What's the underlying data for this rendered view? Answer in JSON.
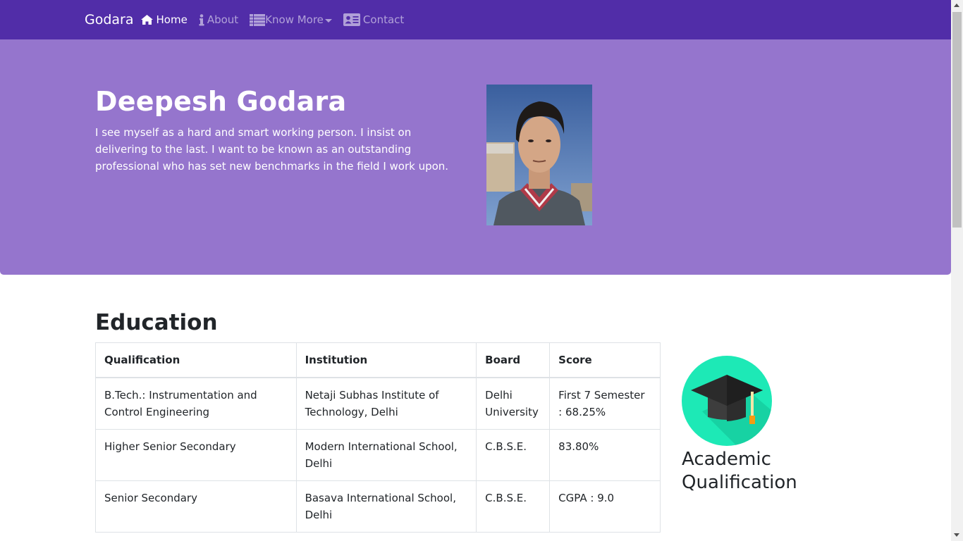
{
  "navbar": {
    "brand": "Godara",
    "items": [
      {
        "label": "Home",
        "icon": "home-icon"
      },
      {
        "label": "About",
        "icon": "info-icon"
      },
      {
        "label": "Know More",
        "icon": "list-icon"
      },
      {
        "label": "Contact",
        "icon": "address-card-icon"
      }
    ]
  },
  "hero": {
    "name": "Deepesh Godara",
    "description": "I see myself as a hard and smart working person. I insist on delivering to the last. I want to be known as an outstanding professional who has set new benchmarks in the field I work upon."
  },
  "education": {
    "title": "Education",
    "headers": [
      "Qualification",
      "Institution",
      "Board",
      "Score"
    ],
    "rows": [
      [
        "B.Tech.: Instrumentation and Control Engineering",
        "Netaji Subhas Institute of Technology, Delhi",
        "Delhi University",
        "First 7 Semester : 68.25%"
      ],
      [
        "Higher Senior Secondary",
        "Modern International School, Delhi",
        "C.B.S.E.",
        "83.80%"
      ],
      [
        "Senior Secondary",
        "Basava International School, Delhi",
        "C.B.S.E.",
        "CGPA : 9.0"
      ]
    ],
    "side_title": "Academic Qualification"
  },
  "colors": {
    "navbar": "#512da8",
    "jumbotron": "#9575cd",
    "icon_bg": "#1de9b6"
  }
}
